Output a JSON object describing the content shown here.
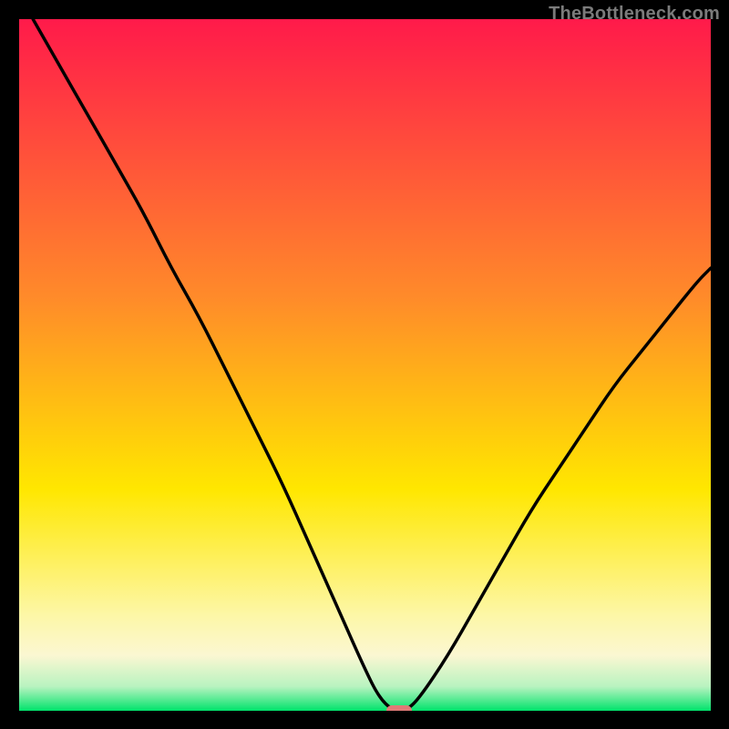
{
  "watermark": {
    "text": "TheBottleneck.com"
  },
  "colors": {
    "black": "#000000",
    "red": "#ff1a4a",
    "orange": "#ff8a2a",
    "yellow": "#ffe700",
    "lightyellow": "#fdf7a5",
    "paleband": "#fbf7d2",
    "green": "#00e36b",
    "curve": "#000000",
    "marker": "#e07a77"
  },
  "layout": {
    "image_size": 800,
    "plot_inset": 21,
    "plot_size": 759
  },
  "chart_data": {
    "type": "line",
    "title": "",
    "xlabel": "",
    "ylabel": "",
    "xlim": [
      0,
      100
    ],
    "ylim": [
      0,
      100
    ],
    "grid": false,
    "legend": false,
    "annotations": [],
    "background_gradient_stops": [
      {
        "pos": 0.0,
        "color": "#ff1a4a"
      },
      {
        "pos": 0.4,
        "color": "#ff8a2a"
      },
      {
        "pos": 0.68,
        "color": "#ffe700"
      },
      {
        "pos": 0.86,
        "color": "#fdf7a5"
      },
      {
        "pos": 0.92,
        "color": "#fbf7d2"
      },
      {
        "pos": 0.965,
        "color": "#b8f3c0"
      },
      {
        "pos": 1.0,
        "color": "#00e36b"
      }
    ],
    "series": [
      {
        "name": "bottleneck-curve",
        "draw": "line",
        "color": "#000000",
        "x": [
          2,
          6,
          10,
          14,
          18,
          22,
          26,
          30,
          34,
          38,
          42,
          46,
          50,
          52,
          54,
          56,
          58,
          62,
          66,
          70,
          74,
          78,
          82,
          86,
          90,
          94,
          98,
          100
        ],
        "y": [
          100,
          93,
          86,
          79,
          72,
          64,
          57,
          49,
          41,
          33,
          24,
          15,
          6,
          2,
          0,
          0,
          2,
          8,
          15,
          22,
          29,
          35,
          41,
          47,
          52,
          57,
          62,
          64
        ]
      }
    ],
    "marker": {
      "x": 55,
      "y": 0,
      "shape": "pill",
      "color": "#e07a77"
    }
  }
}
